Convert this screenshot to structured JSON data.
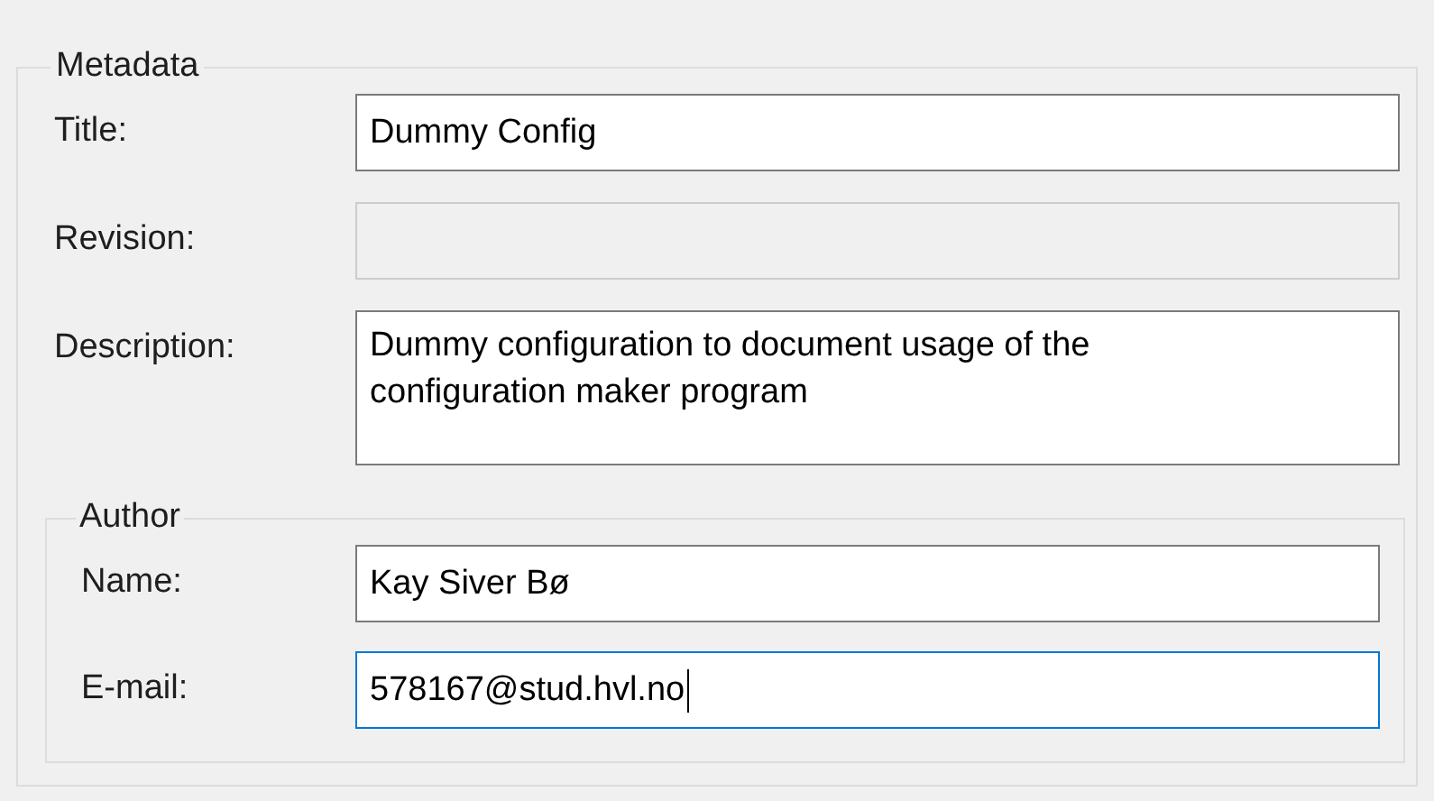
{
  "metadata": {
    "legend": "Metadata",
    "fields": [
      {
        "kind": "line",
        "label": "Title:",
        "value": "Dummy Config",
        "disabled": false,
        "focused": false
      },
      {
        "kind": "line",
        "label": "Revision:",
        "disabled": true,
        "focused": false
      },
      {
        "kind": "multiline",
        "label": "Description:",
        "value": "Dummy configuration to document usage of the configuration maker program",
        "disabled": false,
        "focused": false
      }
    ],
    "author": {
      "legend": "Author",
      "fields": [
        {
          "kind": "line",
          "label": "Name:",
          "value": "Kay Siver Bø",
          "disabled": false,
          "focused": false
        },
        {
          "kind": "line",
          "label": "E-mail:",
          "value": "578167@stud.hvl.no",
          "disabled": false,
          "focused": true
        }
      ]
    }
  }
}
